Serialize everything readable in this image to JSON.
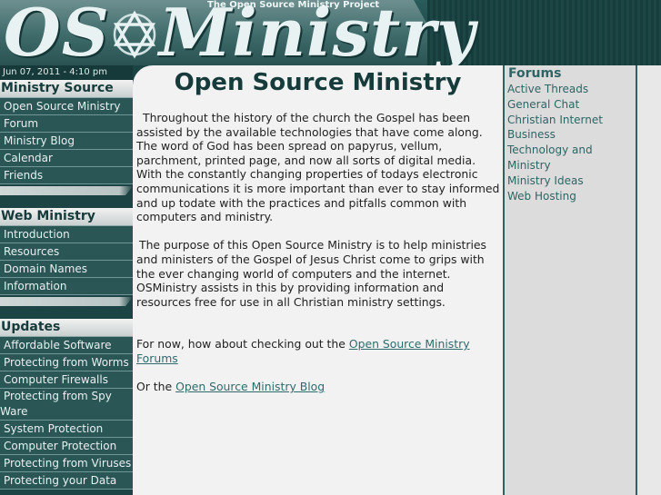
{
  "header": {
    "tagline": "The Open Source Ministry Project",
    "logo_left": "OS",
    "logo_right": "Ministry"
  },
  "date": "Jun 07, 2011 - 4:10 pm",
  "sections": {
    "ministry_source": {
      "title": "Ministry Source",
      "items": [
        "Open Source Ministry",
        "Forum",
        "Ministry Blog",
        "Calendar",
        "Friends"
      ]
    },
    "web_ministry": {
      "title": "Web Ministry",
      "items": [
        "Introduction",
        "Resources",
        "Domain Names",
        "Information"
      ]
    },
    "updates": {
      "title": "Updates",
      "items": [
        "Affordable Software",
        "Protecting from Worms",
        "Computer Firewalls",
        "Protecting from Spy Ware",
        "System Protection",
        "Computer Protection",
        "Protecting from Viruses",
        "Protecting your Data"
      ]
    }
  },
  "main": {
    "title": "Open Source Ministry",
    "para1": "Throughout the history of the church the Gospel has been assisted by the available technologies that have come along. The word of God has been spread on papyrus, vellum, parchment, printed page, and now all sorts of digital media. With the constantly changing properties of todays electronic communications it is more important than ever to stay informed and up todate with the practices and pitfalls common with computers and ministry.",
    "para2": "The purpose of this Open Source Ministry is to help ministries and ministers of the Gospel of Jesus Christ come to grips with the ever changing world of computers and the internet. OSMinistry assists in this by providing information and resources free for use in all Christian ministry settings.",
    "para3_prefix": "For now, how about checking out the",
    "para3_link": "Open Source Ministry Forums",
    "para4_prefix": "Or the",
    "para4_link": "Open Source Ministry Blog"
  },
  "forums": {
    "title": "Forums",
    "items": [
      "Active Threads",
      "General Chat",
      "Christian Internet Business",
      "Technology and Ministry",
      "Ministry Ideas",
      "Web Hosting"
    ]
  },
  "colors": {
    "dark_teal": "#1c4444",
    "nav_item_bg": "#2a5656",
    "title_text": "#173b3b",
    "link": "#2f6b6b",
    "content_bg": "#f2f2f2",
    "sidebar_right_bg": "#dcdcdc"
  }
}
